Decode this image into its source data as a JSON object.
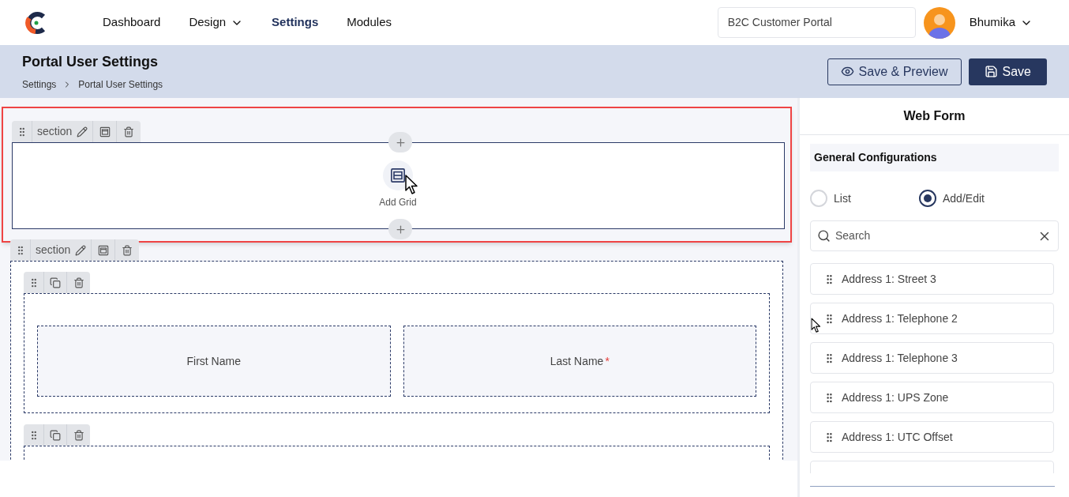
{
  "nav": {
    "items": [
      {
        "label": "Dashboard",
        "selected": false,
        "has_menu": false
      },
      {
        "label": "Design",
        "selected": false,
        "has_menu": true
      },
      {
        "label": "Settings",
        "selected": true,
        "has_menu": false
      },
      {
        "label": "Modules",
        "selected": false,
        "has_menu": false
      }
    ],
    "portal": "B2C Customer Portal",
    "user": "Bhumika"
  },
  "page": {
    "title": "Portal User Settings",
    "breadcrumb": [
      "Settings",
      "Portal User Settings"
    ],
    "actions": [
      {
        "label": "Save & Preview",
        "kind": "outline"
      },
      {
        "label": "Save",
        "kind": "primary"
      }
    ]
  },
  "canvas": {
    "sections": [
      {
        "label": "section",
        "selected": true,
        "add_grid_label": "Add Grid"
      },
      {
        "label": "section",
        "selected": false,
        "rows": [
          {
            "fields": [
              {
                "label": "First Name",
                "required": false
              },
              {
                "label": "Last Name",
                "required": true,
                "required_mark": "*"
              }
            ]
          },
          {
            "fields": []
          }
        ]
      }
    ]
  },
  "panel": {
    "title": "Web Form",
    "config_heading": "General Configurations",
    "view_options": [
      {
        "label": "List",
        "selected": false
      },
      {
        "label": "Add/Edit",
        "selected": true
      }
    ],
    "search": {
      "placeholder": "Search"
    },
    "fields": [
      "Address 1: Street 3",
      "Address 1: Telephone 2",
      "Address 1: Telephone 3",
      "Address 1: UPS Zone",
      "Address 1: UTC Offset"
    ]
  }
}
